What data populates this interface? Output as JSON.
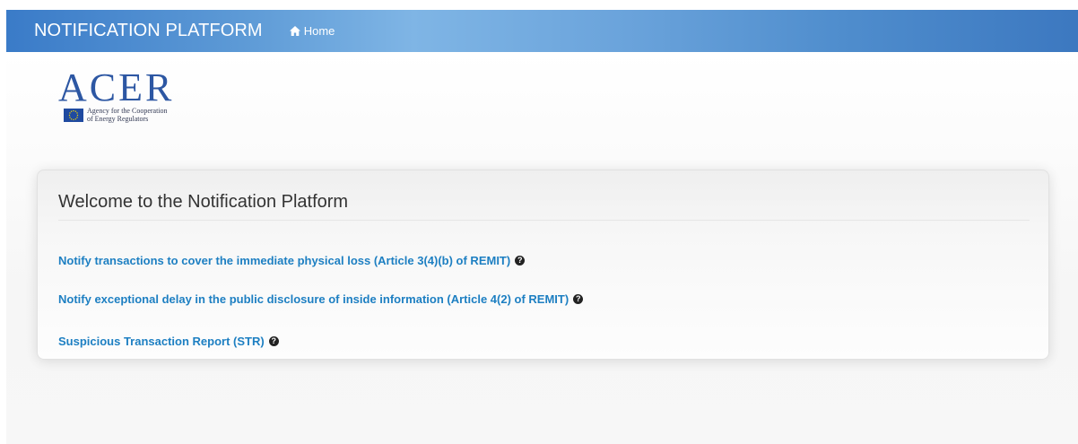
{
  "navbar": {
    "brand": "NOTIFICATION PLATFORM",
    "home_label": "Home",
    "home_icon": "home-icon"
  },
  "logo": {
    "word": "ACER",
    "subtitle_line1": "Agency for the Cooperation",
    "subtitle_line2": "of Energy Regulators"
  },
  "panel": {
    "title": "Welcome to the Notification Platform",
    "links": [
      {
        "label": "Notify transactions to cover the immediate physical loss (Article 3(4)(b) of REMIT)",
        "icon": "question-circle-icon"
      },
      {
        "label": "Notify exceptional delay in the public disclosure of inside information (Article 4(2) of REMIT)",
        "icon": "question-circle-icon"
      },
      {
        "label": "Suspicious Transaction Report (STR)",
        "icon": "question-circle-icon"
      }
    ]
  },
  "colors": {
    "navbar_gradient_start": "#3a7bc8",
    "navbar_gradient_mid": "#7fb5e5",
    "link": "#1d7fc2",
    "logo": "#2d57a3"
  }
}
